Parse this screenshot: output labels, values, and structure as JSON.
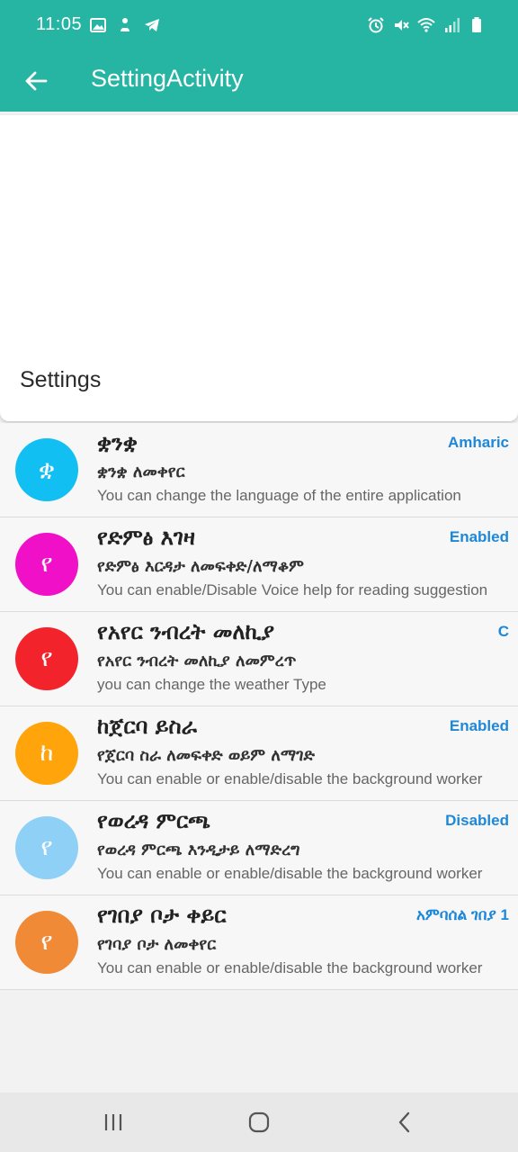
{
  "status_bar": {
    "time": "11:05",
    "left_icons": [
      "image-icon",
      "app-notification-icon",
      "telegram-icon"
    ],
    "right_icons": [
      "alarm-icon",
      "mute-icon",
      "wifi-icon",
      "signal-icon",
      "battery-icon"
    ]
  },
  "app_bar": {
    "title": "SettingActivity",
    "back_icon": "arrow-left-icon",
    "color": "#26b5a3"
  },
  "header": {
    "title": "Settings"
  },
  "settings": [
    {
      "avatar_letter": "ቋ",
      "avatar_color": "#12bff2",
      "title": "ቋንቋ",
      "subtitle": "ቋንቋ ለመቀየር",
      "description": "You can change the language of the entire application",
      "value": "Amharic"
    },
    {
      "avatar_letter": "የ",
      "avatar_color": "#f010c8",
      "title": "የድምፅ እገዛ",
      "subtitle": "የድምፅ እርዳታ ለመፍቀድ/ለማቆም",
      "description": "You can enable/Disable Voice help for reading suggestion",
      "value": "Enabled"
    },
    {
      "avatar_letter": "የ",
      "avatar_color": "#f3232b",
      "title": "የአየር ንብረት መለኪያ",
      "subtitle": "የአየር ንብረት መለኪያ ለመምረጥ",
      "description": "you can change the weather Type",
      "value": "C"
    },
    {
      "avatar_letter": "ከ",
      "avatar_color": "#ffa40b",
      "title": "ከጀርባ ይስራ",
      "subtitle": "የጀርባ ስራ ለመፍቀድ ወይም ለማገድ",
      "description": "You can enable or enable/disable the background worker",
      "value": "Enabled"
    },
    {
      "avatar_letter": "የ",
      "avatar_color": "#8fd0f7",
      "title": "የወረዳ ምርጫ",
      "subtitle": "የወረዳ ምርጫ እንዲታይ ለማድረግ",
      "description": "You can enable or enable/disable the background worker",
      "value": "Disabled"
    },
    {
      "avatar_letter": "የ",
      "avatar_color": "#f08a37",
      "title": "የገበያ ቦታ ቀይር",
      "subtitle": "የገባያ ቦታ ለመቀየር",
      "description": "You can enable or enable/disable the background worker",
      "value": "አምባሰል ገበያ 1"
    }
  ],
  "nav_bar": {
    "buttons": [
      "recent-apps-icon",
      "home-icon",
      "back-icon"
    ]
  }
}
